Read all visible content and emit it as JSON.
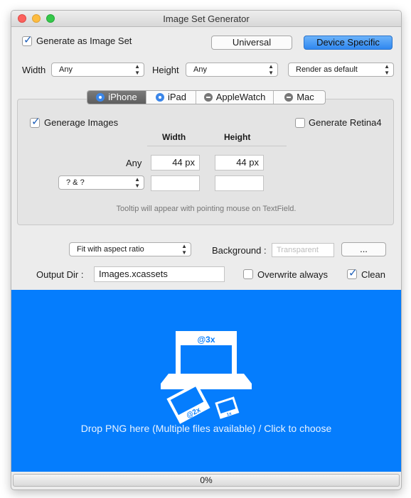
{
  "window": {
    "title": "Image Set Generator"
  },
  "top": {
    "generate_as_image_set": {
      "label": "Generate as Image Set",
      "checked": true
    },
    "universal_label": "Universal",
    "device_specific_label": "Device Specific",
    "width_label": "Width",
    "width_value": "Any",
    "height_label": "Height",
    "height_value": "Any",
    "render_value": "Render as default"
  },
  "tabs": [
    {
      "label": "iPhone",
      "selected": true,
      "radio": "on"
    },
    {
      "label": "iPad",
      "selected": false,
      "radio": "on"
    },
    {
      "label": "AppleWatch",
      "selected": false,
      "radio": "off"
    },
    {
      "label": "Mac",
      "selected": false,
      "radio": "off"
    }
  ],
  "panel": {
    "generage_images": {
      "label": "Generage Images",
      "checked": true
    },
    "generate_retina4": {
      "label": "Generate Retina4",
      "checked": false
    },
    "col_width": "Width",
    "col_height": "Height",
    "row_any_label": "Any",
    "any_width": "44 px",
    "any_height": "44 px",
    "size_class_value": "? & ?",
    "tooltip_hint": "Tooltip will appear with pointing mouse on TextField."
  },
  "options": {
    "fit_value": "Fit with aspect ratio",
    "background_label": "Background :",
    "background_placeholder": "Transparent",
    "ellipsis_label": "...",
    "output_dir_label": "Output Dir :",
    "output_dir_value": "Images.xcassets",
    "overwrite": {
      "label": "Overwrite always",
      "checked": false
    },
    "clean": {
      "label": "Clean",
      "checked": true
    }
  },
  "drop": {
    "text": "Drop PNG here (Multiple files available) / Click to choose",
    "badge_3x": "@3x",
    "badge_2x": "@2x",
    "badge_1x": "1x",
    "icon": "xcassets-drop-icon"
  },
  "progress": {
    "text": "0%",
    "value": 0
  },
  "colors": {
    "accent": "#057dfd",
    "selected_button": "#2f87f0"
  }
}
